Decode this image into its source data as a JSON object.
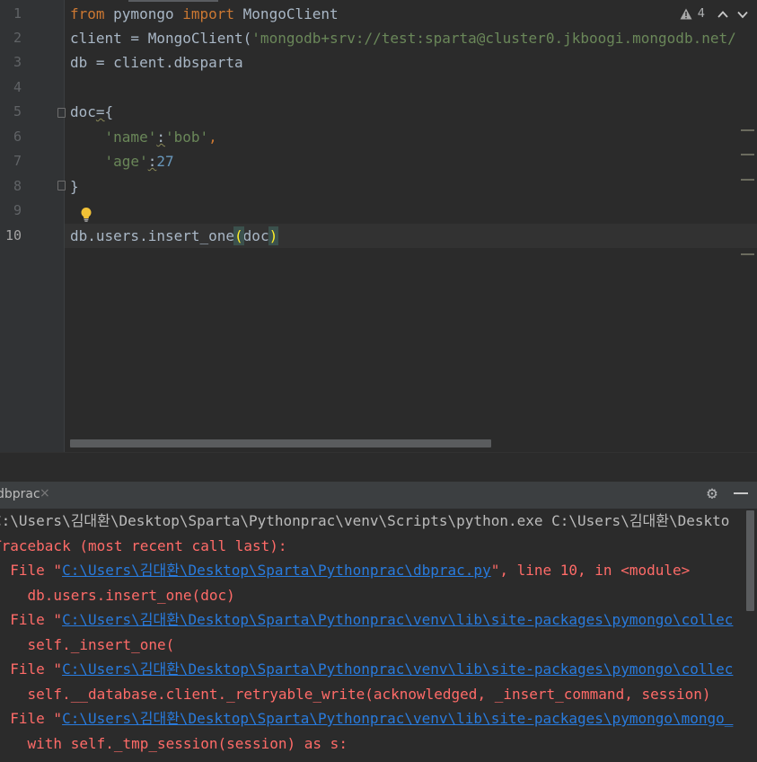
{
  "editor": {
    "line_numbers": [
      "1",
      "2",
      "3",
      "4",
      "5",
      "6",
      "7",
      "8",
      "9",
      "10"
    ],
    "active_line": "10",
    "code": {
      "l1": {
        "kw1": "from",
        "mod": " pymongo ",
        "kw2": "import",
        "name": " MongoClient"
      },
      "l2": {
        "pre": "client = MongoClient(",
        "str": "'mongodb+srv://test:sparta@cluster0.jkboogi.mongodb.net/"
      },
      "l3": {
        "text": "db = client.dbsparta"
      },
      "l5": {
        "name": "doc",
        "op": "=",
        "rest": "{"
      },
      "l6": {
        "indent": "    ",
        "key": "'name'",
        "colon": ":",
        "val": "'bob'",
        "comma": ","
      },
      "l7": {
        "indent": "    ",
        "key": "'age'",
        "colon": ":",
        "val": "27"
      },
      "l8": {
        "text": "}"
      },
      "l10": {
        "pre": "db.users.insert_one",
        "open": "(",
        "arg": "doc",
        "close": ")"
      }
    },
    "inspections": {
      "warning_count": "4",
      "warning_icon": "warning-triangle-icon",
      "up_icon": "chevron-up-icon",
      "down_icon": "chevron-down-icon"
    },
    "intention_icon": "lightbulb-icon"
  },
  "run_panel": {
    "tab_label": "dbprac",
    "close_glyph": "×",
    "settings_icon": "gear-icon",
    "minimize_icon": "minimize-icon",
    "console": {
      "cmd": "C:\\Users\\김대환\\Desktop\\Sparta\\Pythonprac\\venv\\Scripts\\python.exe C:\\Users\\김대환\\Deskto",
      "traceback": "Traceback (most recent call last):",
      "frames": [
        {
          "prefix": "  File \"",
          "path": "C:\\Users\\김대환\\Desktop\\Sparta\\Pythonprac\\dbprac.py",
          "suffix": "\", line 10, in <module>",
          "code": "    db.users.insert_one(doc)"
        },
        {
          "prefix": "  File \"",
          "path": "C:\\Users\\김대환\\Desktop\\Sparta\\Pythonprac\\venv\\lib\\site-packages\\pymongo\\collec",
          "suffix": "",
          "code": "    self._insert_one("
        },
        {
          "prefix": "  File \"",
          "path": "C:\\Users\\김대환\\Desktop\\Sparta\\Pythonprac\\venv\\lib\\site-packages\\pymongo\\collec",
          "suffix": "",
          "code": "    self.__database.client._retryable_write(acknowledged, _insert_command, session)"
        },
        {
          "prefix": "  File \"",
          "path": "C:\\Users\\김대환\\Desktop\\Sparta\\Pythonprac\\venv\\lib\\site-packages\\pymongo\\mongo_",
          "suffix": "",
          "code": "    with self._tmp_session(session) as s:"
        }
      ]
    }
  },
  "colors": {
    "background": "#2b2b2b",
    "keyword": "#cc7832",
    "string": "#6a8759",
    "number": "#6897bb",
    "error": "#ff6b68",
    "link": "#287bde"
  }
}
